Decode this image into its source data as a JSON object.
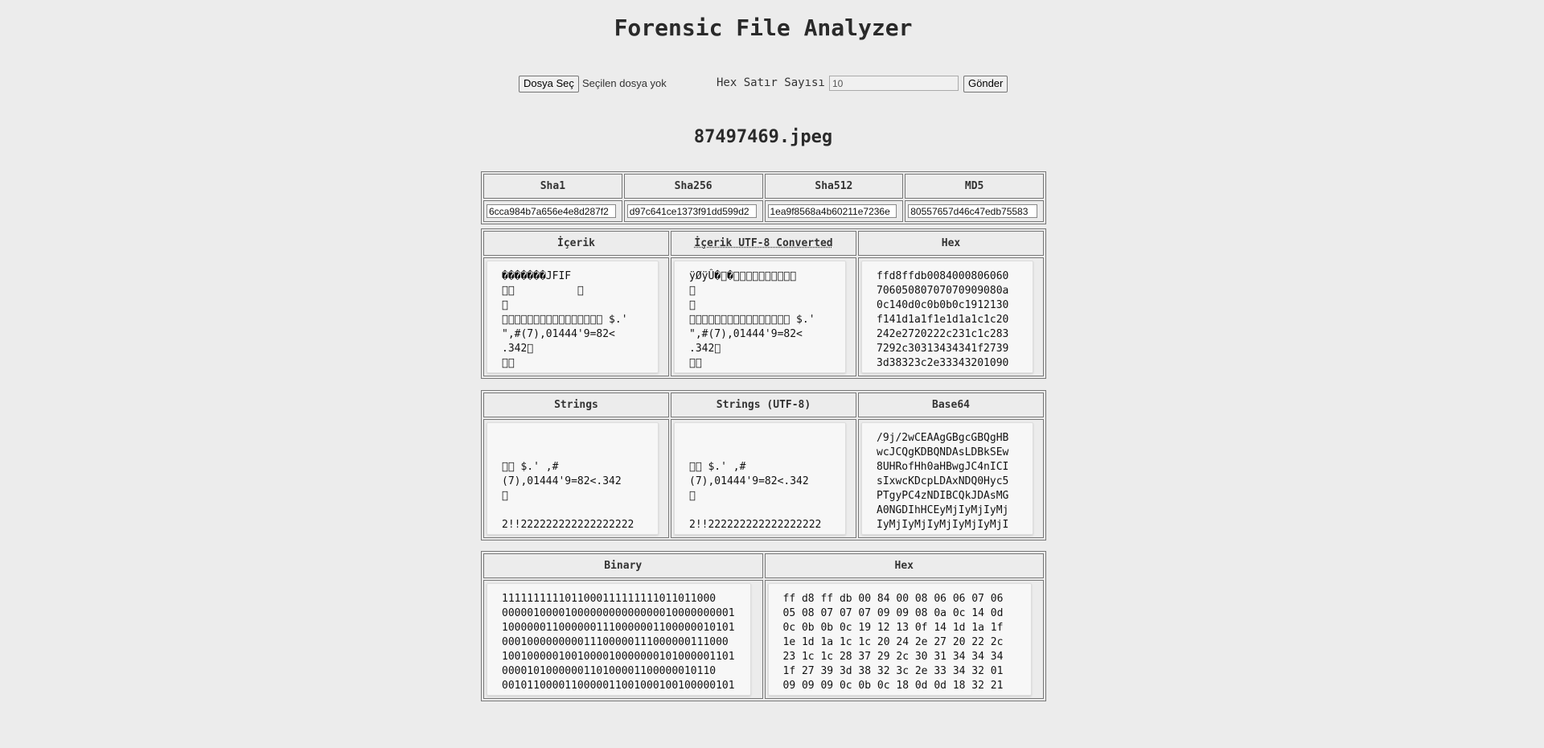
{
  "page": {
    "title": "Forensic File Analyzer"
  },
  "controls": {
    "file_button": "Dosya Seç",
    "file_status": "Seçilen dosya yok",
    "hex_rows_label": "Hex Satır Sayısı",
    "hex_rows_value": "10",
    "submit_button": "Gönder"
  },
  "file": {
    "name": "87497469.jpeg"
  },
  "hashes": {
    "headers": [
      "Sha1",
      "Sha256",
      "Sha512",
      "MD5"
    ],
    "values": [
      "6cca984b7a656e4e8d287f2",
      "d97c641ce1373f91dd599d2",
      "1ea9f8568a4b60211e7236e",
      "80557657d46c47edb75583"
    ]
  },
  "content": {
    "headers": [
      "İçerik",
      "İçerik UTF-8 Converted",
      "Hex"
    ],
    "icerik": "�������\u0010JFIF\u0000\u0001\u0001\u0000\u0000\u0001\n\u0000\u0001          \u0000\n\u0000\n\u0000\u0000\u0000\u0000\u0000\u0000\u0000\u0000\u0000\u0000\u0000\u0000\u0000\u0000\u0000\u0000 $.'\n\",#\u001c\u001c(7),01444\u001f'9=82<\n.342\u0000\n\u0000\u0000",
    "icerik_utf8": "ÿØÿÛ�\u0000�\u0000\u0000\u0000\u0000\u0000\u0000\u0000\u0000\u0000\u0000\n\u0000\n\u0000\n\u0000\u0000\u0000\u0000\u0000\u0000\u0000\u0000\u0000\u0000\u0000\u0000\u0000\u0000\u0000\u0000 $.'\n\",#\u001c\u001c(7),01444\u001f'9=82<\n.342\u0000\n\u0000\u0000",
    "hex": "ffd8ffdb0084000806060\n70605080707070909080a\n0c140d0c0b0b0c1912130\nf141d1a1f1e1d1a1c1c20\n242e2720222c231c1c283\n7292c30313434341f2739\n3d38323c2e33343201090"
  },
  "strings": {
    "headers": [
      "Strings",
      "Strings (UTF-8)",
      "Base64"
    ],
    "strings": "\n\n\u0000\u0000 $.' ,#\n(7),01444'9=82<.342\n\u0000\n\n2!!222222222222222222",
    "strings_utf8": "\n\n\u0000\u0000 $.' ,#\n(7),01444'9=82<.342\n\u0000\n\n2!!222222222222222222",
    "base64": "/9j/2wCEAAgGBgcGBQgHB\nwcJCQgKDBQNDAsLDBkSEw\n8UHRofHh0aHBwgJC4nICI\nsIxwcKDcpLDAxNDQ0Hyc5\nPTgyPC4zNDIBCQkJDAsMG\nA0NGDIhHCEyMjIyMjIyMj\nIyMjIyMjIyMjIyMjIyMjI"
  },
  "binary": {
    "headers": [
      "Binary",
      "Hex"
    ],
    "binary": "1111111111011000111111111011011000\n0000010000100000000000000010000000001\n1000000110000001110000001100000010101\n000100000000011100000111000000111000\n1001000001001000010000000101000001101\n0000101000000110100001100000010110\n0010110000110000011001000100100000101",
    "hex_spaced": "ff d8 ff db 00 84 00 08 06 06 07 06\n05 08 07 07 07 09 09 08 0a 0c 14 0d\n0c 0b 0b 0c 19 12 13 0f 14 1d 1a 1f\n1e 1d 1a 1c 1c 20 24 2e 27 20 22 2c\n23 1c 1c 28 37 29 2c 30 31 34 34 34\n1f 27 39 3d 38 32 3c 2e 33 34 32 01\n09 09 09 0c 0b 0c 18 0d 0d 18 32 21"
  }
}
